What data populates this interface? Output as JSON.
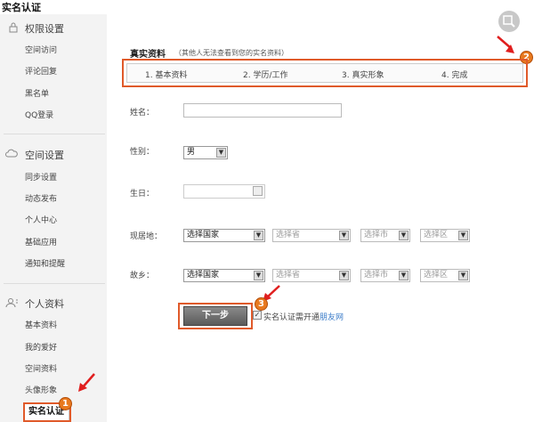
{
  "page": {
    "title": "实名认证"
  },
  "sidebar": {
    "sections": [
      {
        "title": "权限设置",
        "items": [
          "空间访问",
          "评论回复",
          "黑名单",
          "QQ登录"
        ]
      },
      {
        "title": "空间设置",
        "items": [
          "同步设置",
          "动态发布",
          "个人中心",
          "基础应用",
          "通知和提醒"
        ]
      },
      {
        "title": "个人资料",
        "items": [
          "基本资料",
          "我的爱好",
          "空间资料",
          "头像形象",
          "实名认证"
        ]
      }
    ],
    "icons": [
      "lock-icon",
      "cloud-icon",
      "person-icon"
    ]
  },
  "main": {
    "heading": "真实资料",
    "subheading": "（其他人无法查看到您的实名资料）",
    "steps": [
      "1. 基本资料",
      "2. 学历/工作",
      "3. 真实形象",
      "4. 完成"
    ],
    "form": {
      "name_label": "姓名：",
      "name_value": "",
      "gender_label": "性别：",
      "gender_value": "男",
      "birthday_label": "生日：",
      "birthday_value": "",
      "residence_label": "现居地：",
      "residence": {
        "country": "选择国家",
        "province": "选择省",
        "city": "选择市",
        "district": "选择区"
      },
      "hometown_label": "故乡：",
      "hometown": {
        "country": "选择国家",
        "province": "选择省",
        "city": "选择市",
        "district": "选择区"
      }
    },
    "next_button": "下一步",
    "agree_text": "实名认证需开通",
    "agree_link": "朋友网",
    "agree_checked": true
  },
  "annotations": {
    "badges": [
      "1",
      "2",
      "3"
    ],
    "color": "#e05a2a"
  }
}
